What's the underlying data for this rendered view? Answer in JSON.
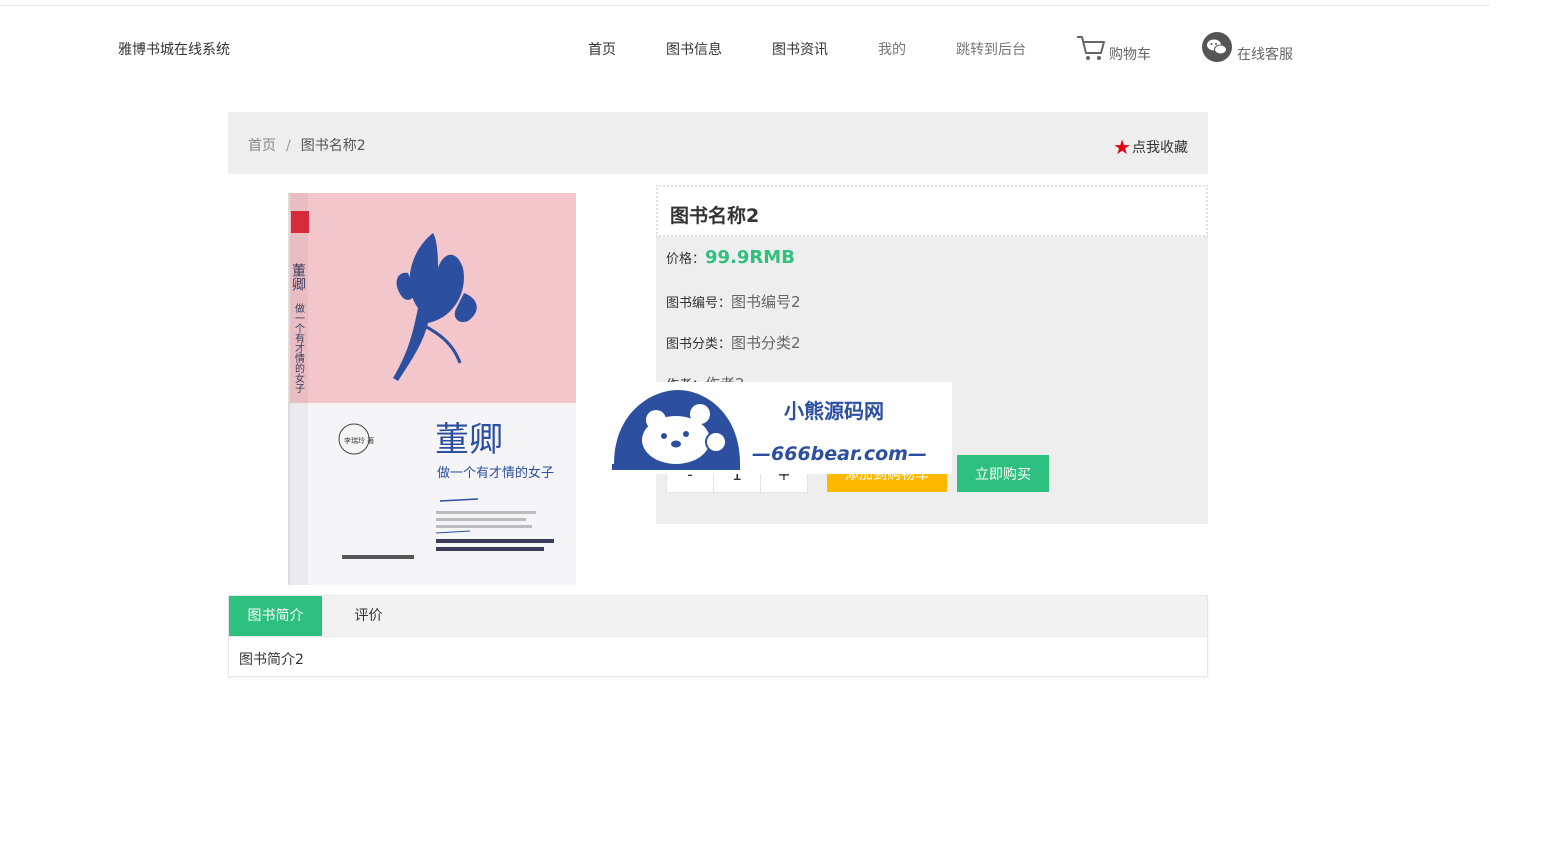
{
  "site": {
    "name": "雅博书城在线系统"
  },
  "nav": {
    "items": [
      "首页",
      "图书信息",
      "图书资讯",
      "我的",
      "跳转到后台"
    ],
    "cart": "购物车",
    "service": "在线客服"
  },
  "breadcrumb": {
    "home": "首页",
    "separator": "/",
    "current": "图书名称2",
    "favorite": "点我收藏"
  },
  "book": {
    "name": "图书名称2",
    "price_label": "价格：",
    "price": "99.9RMB",
    "code_label": "图书编号：",
    "code": "图书编号2",
    "category_label": "图书分类：",
    "category": "图书分类2",
    "author_label": "作者：",
    "author": "作者2",
    "cover": {
      "title": "董卿",
      "subtitle": "做一个有才情的女子",
      "author": "李瑞玲 著"
    }
  },
  "purchase": {
    "minus": "-",
    "quantity": "1",
    "plus": "+",
    "add_to_cart": "添加到购物车",
    "buy_now": "立即购买"
  },
  "tabs": {
    "items": [
      "图书简介",
      "评价"
    ],
    "content": "图书简介2"
  },
  "watermark": {
    "title": "小熊源码网",
    "url": "—666bear.com—"
  },
  "colors": {
    "accent": "#2ec07e",
    "warning": "#ffb800",
    "star": "#e60012",
    "panel": "#eeeeee"
  }
}
